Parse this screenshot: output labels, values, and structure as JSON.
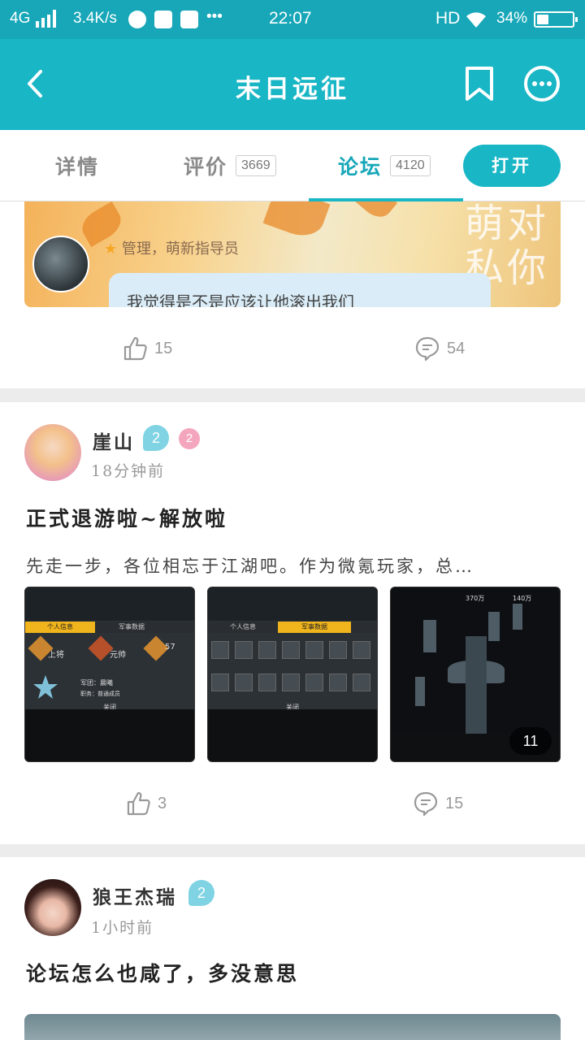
{
  "status_bar": {
    "network": "4G",
    "speed": "3.4K/s",
    "more": "•••",
    "time": "22:07",
    "hd": "HD",
    "battery": "34%",
    "battery_level": 0.34,
    "icons": [
      "qq-icon",
      "browser-icon",
      "vivo-store-icon"
    ]
  },
  "header": {
    "title": "末日远征",
    "back_icon": "back-arrow-icon",
    "bookmark_icon": "bookmark-icon",
    "more_icon": "more-circle-icon"
  },
  "tabs": [
    {
      "label": "详情",
      "count": "",
      "active": false
    },
    {
      "label": "评价",
      "count": "3669",
      "active": false
    },
    {
      "label": "论坛",
      "count": "4120",
      "active": true
    }
  ],
  "open_button": "打开",
  "posts": [
    {
      "banner": {
        "role": "管理，萌新指导员",
        "bubble_text": "我觉得是不是应该让他滚出我们",
        "deco_left": "萌",
        "deco_right": "对",
        "deco_left2": "私",
        "deco_right2": "你"
      },
      "likes": "15",
      "comments": "54"
    },
    {
      "author": "崖山",
      "level": "2",
      "badge": "2",
      "time": "18分钟前",
      "title": "正式退游啦~解放啦",
      "body": "先走一步，各位相忘于江湖吧。作为微氪玩家，总…",
      "images": [
        {
          "tabs": [
            "个人信息",
            "军事数据"
          ],
          "active_tab": 0,
          "labels": [
            "上将",
            "元帅",
            "57",
            "军团：晨曦",
            "职务：普通成员",
            "关闭"
          ]
        },
        {
          "tabs": [
            "个人信息",
            "军事数据"
          ],
          "active_tab": 1,
          "labels": [
            "关闭"
          ]
        },
        {
          "labels": [
            "370万",
            "140万"
          ],
          "more_count": "11"
        }
      ],
      "likes": "3",
      "comments": "15"
    },
    {
      "author": "狼王杰瑞",
      "level": "2",
      "time": "1小时前",
      "title": "论坛怎么也咸了，多没意思"
    }
  ],
  "colors": {
    "accent": "#19b6c6",
    "status_bar": "#17a7b8",
    "level_badge": "#7fd3e3",
    "pink_badge": "#f4a6be"
  }
}
